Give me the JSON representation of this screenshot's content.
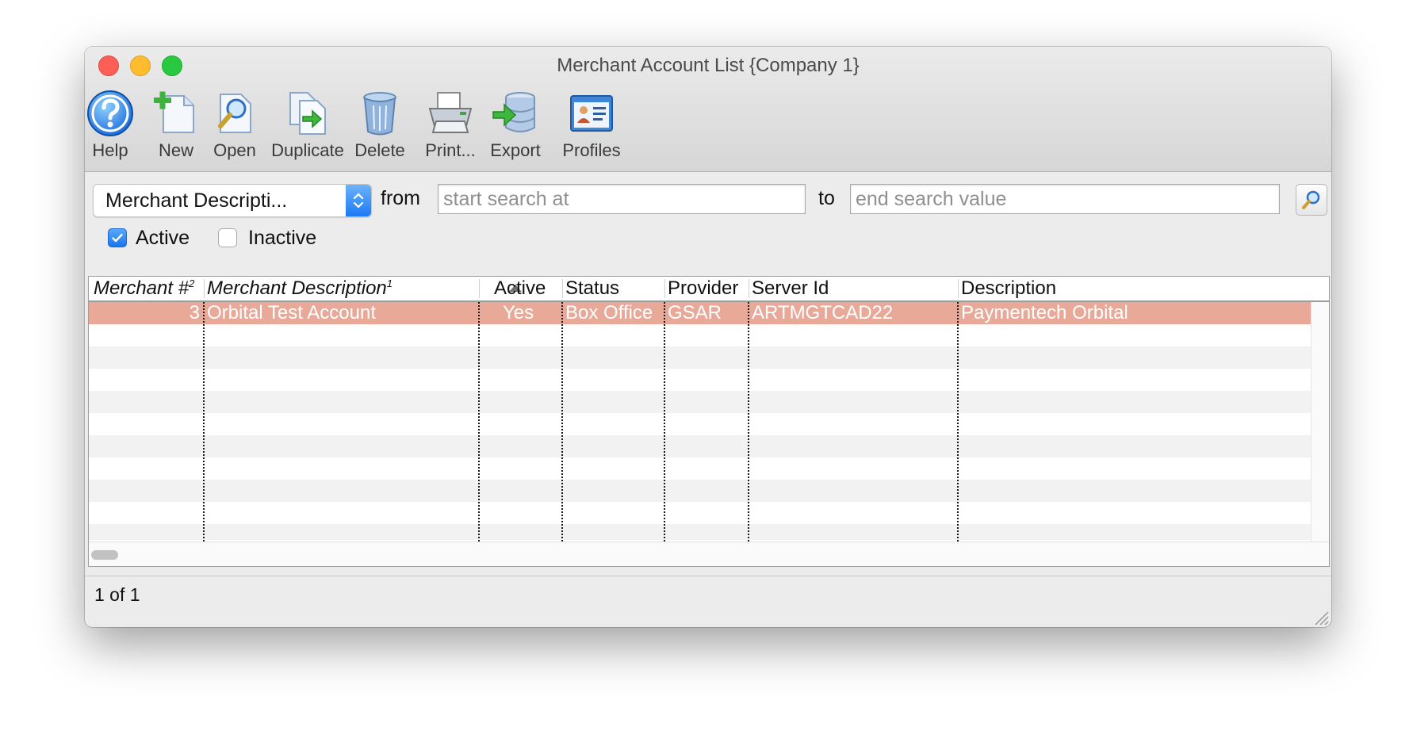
{
  "window": {
    "title": "Merchant Account List {Company 1}"
  },
  "toolbar": {
    "help": "Help",
    "new": "New",
    "open": "Open",
    "duplicate": "Duplicate",
    "delete": "Delete",
    "print": "Print...",
    "export": "Export",
    "profiles": "Profiles"
  },
  "search": {
    "field_select": "Merchant Descripti...",
    "from_label": "from",
    "from_placeholder": "start search at",
    "to_label": "to",
    "to_placeholder": "end search value"
  },
  "filters": {
    "active": {
      "label": "Active",
      "checked": true
    },
    "inactive": {
      "label": "Inactive",
      "checked": false
    }
  },
  "table": {
    "columns": {
      "merchant_no": "Merchant #",
      "merchant_no_sort": "2",
      "merchant_desc": "Merchant Description",
      "merchant_desc_sort": "1",
      "active": "Active",
      "status": "Status",
      "provider": "Provider",
      "server_id": "Server Id",
      "description": "Description"
    },
    "rows": [
      {
        "merchant_no": "3",
        "merchant_desc": "Orbital Test Account",
        "active": "Yes",
        "status": "Box Office",
        "provider": "GSAR",
        "server_id": "ARTMGTCAD22",
        "description": "Paymentech Orbital"
      }
    ]
  },
  "status": {
    "record_count": "1 of 1"
  },
  "colors": {
    "selected_row": "#e8a999",
    "accent": "#1a74f2"
  }
}
